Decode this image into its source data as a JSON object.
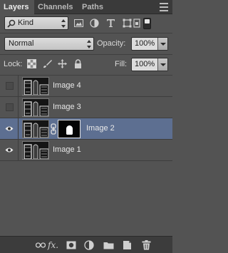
{
  "panel": {
    "tabs": [
      {
        "label": "Layers",
        "active": true
      },
      {
        "label": "Channels",
        "active": false
      },
      {
        "label": "Paths",
        "active": false
      }
    ],
    "menu_icon": "panel-menu-icon"
  },
  "filter": {
    "kind_label": "Kind",
    "icons": [
      "pixel-filter-icon",
      "adjustment-filter-icon",
      "type-filter-icon",
      "shape-filter-icon",
      "smart-object-filter-icon"
    ],
    "filter_toggle": "on"
  },
  "blend": {
    "mode": "Normal",
    "opacity_label": "Opacity:",
    "opacity_value": "100%"
  },
  "lock": {
    "label": "Lock:",
    "icons": [
      "lock-transparent-icon",
      "lock-image-icon",
      "lock-position-icon",
      "lock-all-icon"
    ],
    "fill_label": "Fill:",
    "fill_value": "100%"
  },
  "layers": [
    {
      "name": "Image 4",
      "visible": false,
      "selected": false,
      "has_mask": false
    },
    {
      "name": "Image 3",
      "visible": false,
      "selected": false,
      "has_mask": false
    },
    {
      "name": "Image 2",
      "visible": true,
      "selected": true,
      "has_mask": true
    },
    {
      "name": "Image 1",
      "visible": true,
      "selected": false,
      "has_mask": false
    }
  ],
  "footer": {
    "icons": [
      "link-layers-icon",
      "fx-icon",
      "add-mask-icon",
      "adjustment-layer-icon",
      "new-group-icon",
      "new-layer-icon",
      "delete-layer-icon"
    ],
    "fx_label": "fx."
  },
  "colors": {
    "panel_bg": "#535353",
    "selected_row": "#5d6f91",
    "tab_bar": "#3a3a3a"
  }
}
